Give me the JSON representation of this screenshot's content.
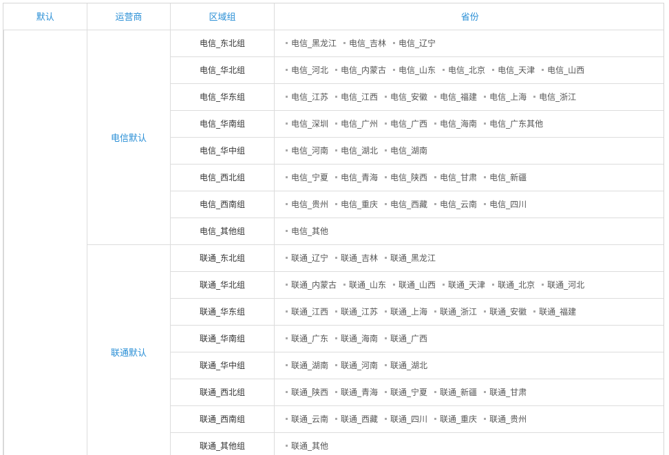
{
  "headers": {
    "default": "默认",
    "carrier": "运营商",
    "region_group": "区域组",
    "province": "省份"
  },
  "carriers": [
    {
      "name": "电信默认",
      "groups": [
        {
          "name": "电信_东北组",
          "provinces": [
            "电信_黑龙江",
            "电信_吉林",
            "电信_辽宁"
          ]
        },
        {
          "name": "电信_华北组",
          "provinces": [
            "电信_河北",
            "电信_内蒙古",
            "电信_山东",
            "电信_北京",
            "电信_天津",
            "电信_山西"
          ]
        },
        {
          "name": "电信_华东组",
          "provinces": [
            "电信_江苏",
            "电信_江西",
            "电信_安徽",
            "电信_福建",
            "电信_上海",
            "电信_浙江"
          ]
        },
        {
          "name": "电信_华南组",
          "provinces": [
            "电信_深圳",
            "电信_广州",
            "电信_广西",
            "电信_海南",
            "电信_广东其他"
          ]
        },
        {
          "name": "电信_华中组",
          "provinces": [
            "电信_河南",
            "电信_湖北",
            "电信_湖南"
          ]
        },
        {
          "name": "电信_西北组",
          "provinces": [
            "电信_宁夏",
            "电信_青海",
            "电信_陕西",
            "电信_甘肃",
            "电信_新疆"
          ]
        },
        {
          "name": "电信_西南组",
          "provinces": [
            "电信_贵州",
            "电信_重庆",
            "电信_西藏",
            "电信_云南",
            "电信_四川"
          ]
        },
        {
          "name": "电信_其他组",
          "provinces": [
            "电信_其他"
          ]
        }
      ]
    },
    {
      "name": "联通默认",
      "groups": [
        {
          "name": "联通_东北组",
          "provinces": [
            "联通_辽宁",
            "联通_吉林",
            "联通_黑龙江"
          ]
        },
        {
          "name": "联通_华北组",
          "provinces": [
            "联通_内蒙古",
            "联通_山东",
            "联通_山西",
            "联通_天津",
            "联通_北京",
            "联通_河北"
          ]
        },
        {
          "name": "联通_华东组",
          "provinces": [
            "联通_江西",
            "联通_江苏",
            "联通_上海",
            "联通_浙江",
            "联通_安徽",
            "联通_福建"
          ]
        },
        {
          "name": "联通_华南组",
          "provinces": [
            "联通_广东",
            "联通_海南",
            "联通_广西"
          ]
        },
        {
          "name": "联通_华中组",
          "provinces": [
            "联通_湖南",
            "联通_河南",
            "联通_湖北"
          ]
        },
        {
          "name": "联通_西北组",
          "provinces": [
            "联通_陕西",
            "联通_青海",
            "联通_宁夏",
            "联通_新疆",
            "联通_甘肃"
          ]
        },
        {
          "name": "联通_西南组",
          "provinces": [
            "联通_云南",
            "联通_西藏",
            "联通_四川",
            "联通_重庆",
            "联通_贵州"
          ]
        },
        {
          "name": "联通_其他组",
          "provinces": [
            "联通_其他"
          ]
        }
      ]
    }
  ]
}
